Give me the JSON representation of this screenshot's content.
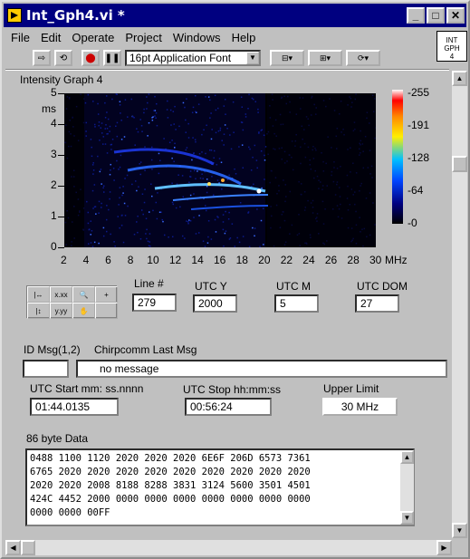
{
  "window": {
    "title": "Int_Gph4.vi *",
    "min_icon": "minimize-icon",
    "max_icon": "maximize-icon",
    "close_icon": "close-icon"
  },
  "menu": [
    "File",
    "Edit",
    "Operate",
    "Project",
    "Windows",
    "Help"
  ],
  "badge": {
    "line1": "INT",
    "line2": "GPH",
    "line3": "4"
  },
  "toolbar": {
    "font": "16pt Application Font"
  },
  "graph": {
    "label": "Intensity Graph 4",
    "y_unit": "ms",
    "x_unit": "MHz",
    "y_ticks": [
      "5",
      "4",
      "3",
      "2",
      "1",
      "0"
    ],
    "x_ticks": [
      "2",
      "4",
      "6",
      "8",
      "10",
      "12",
      "14",
      "16",
      "18",
      "20",
      "22",
      "24",
      "26",
      "28",
      "30"
    ],
    "scale_ticks": [
      "255",
      "191",
      "128",
      "64",
      "0"
    ]
  },
  "chart_data": {
    "type": "heatmap",
    "title": "Intensity Graph 4",
    "xlabel": "MHz",
    "ylabel": "ms",
    "xlim": [
      2,
      30
    ],
    "ylim": [
      0,
      5
    ],
    "zlim": [
      0,
      255
    ]
  },
  "fields": {
    "line_label": "Line #",
    "line_value": "279",
    "utcy_label": "UTC Y",
    "utcy_value": "2000",
    "utcm_label": "UTC M",
    "utcm_value": "5",
    "utcdom_label": "UTC DOM",
    "utcdom_value": "27",
    "idmsg_label": "ID Msg(1,2)",
    "idmsg_value": "",
    "chirp_label": "Chirpcomm Last Msg",
    "chirp_value": "no message",
    "start_label": "UTC Start mm: ss.nnnn",
    "start_value": "01:44.0135",
    "stop_label": "UTC Stop hh:mm:ss",
    "stop_value": "00:56:24",
    "upper_label": "Upper Limit",
    "upper_value": "30 MHz",
    "data_label": "86 byte Data",
    "data_lines": [
      "0488 1100 1120 2020 2020 2020 6E6F 206D 6573 7361",
      "6765 2020 2020 2020 2020 2020 2020 2020 2020 2020",
      "2020 2020 2008 8188 8288 3831 3124 5600 3501 4501",
      "424C 4452 2000 0000 0000 0000 0000 0000 0000 0000",
      "0000 0000 00FF"
    ]
  }
}
